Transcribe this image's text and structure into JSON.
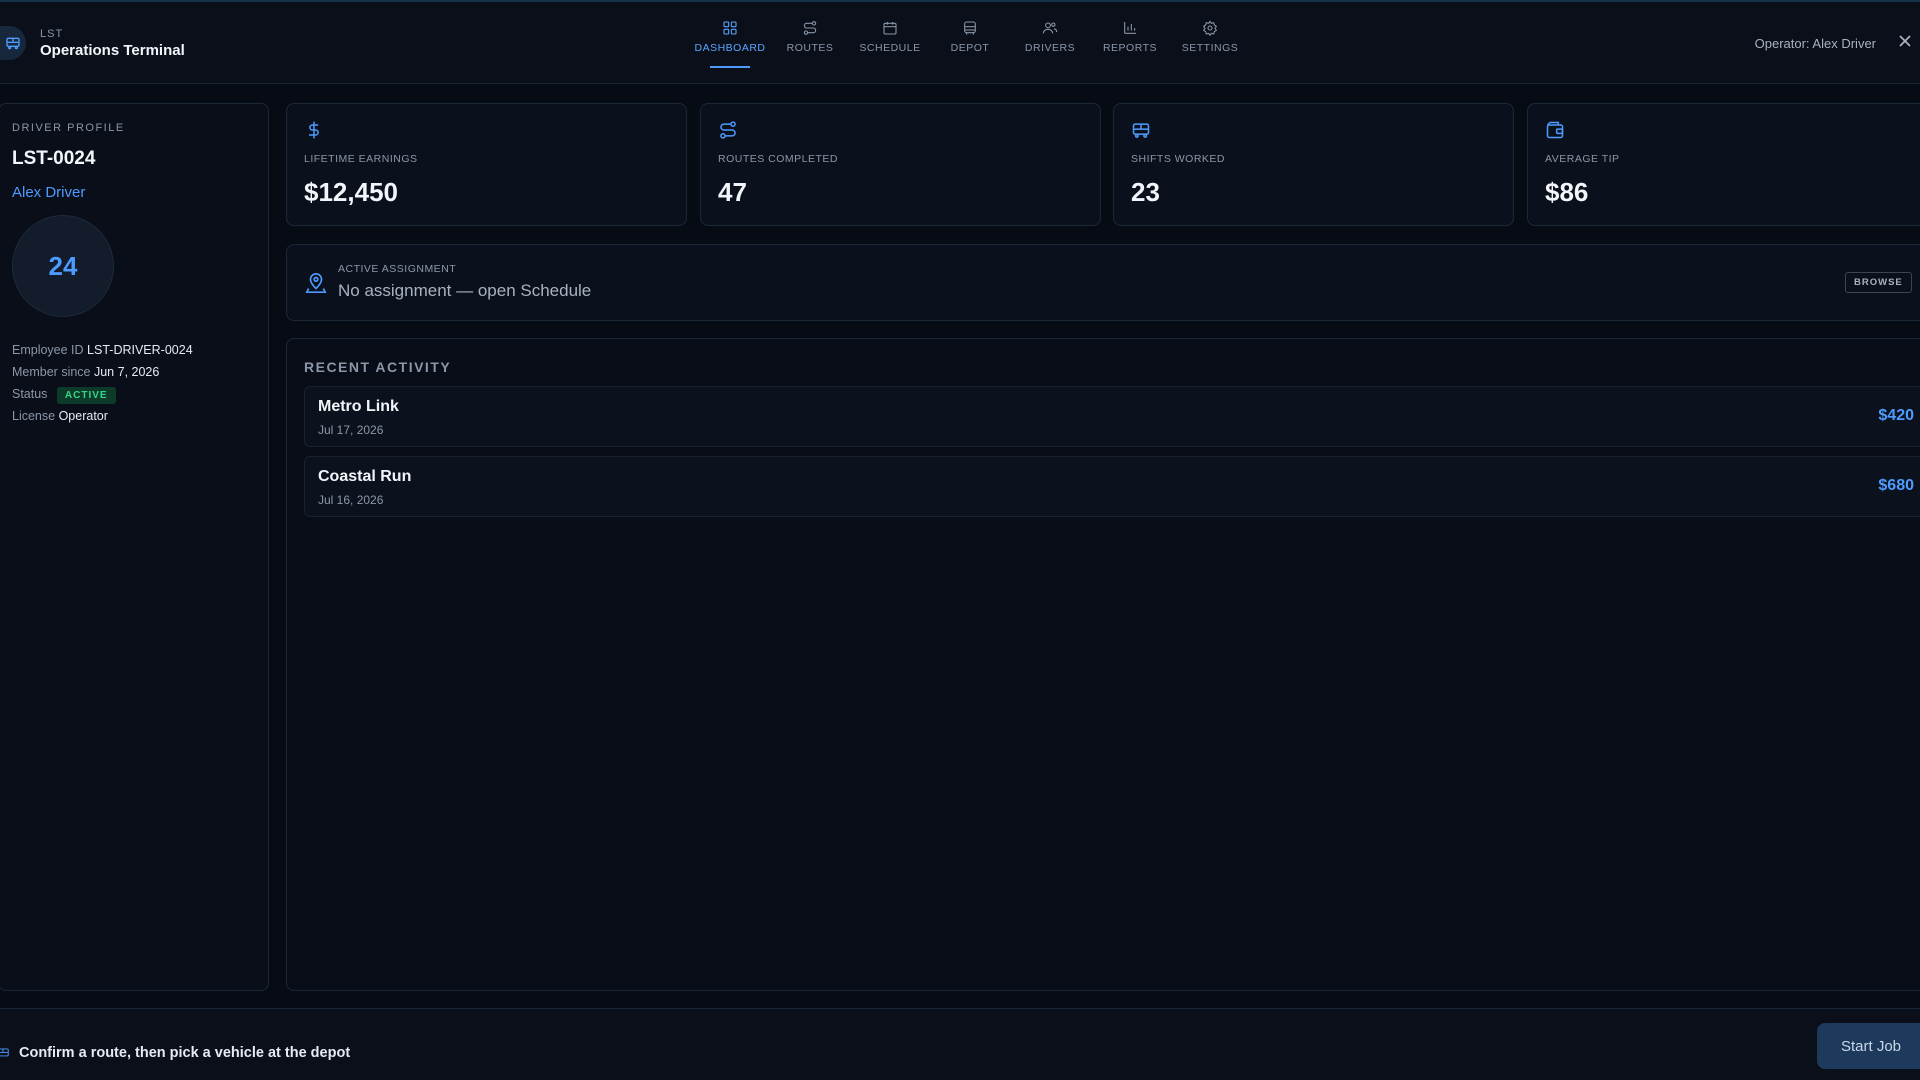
{
  "header": {
    "brand_sub": "LST",
    "brand_title": "Operations Terminal",
    "operator": "Operator: Alex Driver",
    "nav": [
      {
        "label": "DASHBOARD",
        "icon": "grid-icon",
        "active": true
      },
      {
        "label": "ROUTES",
        "icon": "route-icon",
        "active": false
      },
      {
        "label": "SCHEDULE",
        "icon": "calendar-icon",
        "active": false
      },
      {
        "label": "DEPOT",
        "icon": "bus-icon",
        "active": false
      },
      {
        "label": "DRIVERS",
        "icon": "users-icon",
        "active": false
      },
      {
        "label": "REPORTS",
        "icon": "bar-chart-icon",
        "active": false
      },
      {
        "label": "SETTINGS",
        "icon": "gear-icon",
        "active": false
      }
    ]
  },
  "profile": {
    "section_label": "DRIVER PROFILE",
    "id": "LST-0024",
    "name": "Alex Driver",
    "level": "24",
    "employee_id_label": "Employee ID",
    "employee_id": "LST-DRIVER-0024",
    "member_since_label": "Member since",
    "member_since": "Jun 7, 2026",
    "status_label": "Status",
    "status": "ACTIVE",
    "license_label": "License",
    "license": "Operator"
  },
  "stats": [
    {
      "label": "LIFETIME EARNINGS",
      "value": "$12,450",
      "icon": "dollar-icon"
    },
    {
      "label": "ROUTES COMPLETED",
      "value": "47",
      "icon": "route-icon"
    },
    {
      "label": "SHIFTS WORKED",
      "value": "23",
      "icon": "bus-icon"
    },
    {
      "label": "AVERAGE TIP",
      "value": "$86",
      "icon": "wallet-icon"
    }
  ],
  "assignment": {
    "label": "ACTIVE ASSIGNMENT",
    "text": "No assignment — open Schedule",
    "browse_label": "BROWSE"
  },
  "activity": {
    "title": "RECENT ACTIVITY",
    "items": [
      {
        "title": "Metro Link",
        "date": "Jul 17, 2026",
        "amount": "$420"
      },
      {
        "title": "Coastal Run",
        "date": "Jul 16, 2026",
        "amount": "$680"
      }
    ]
  },
  "footer": {
    "hint": "Confirm a route, then pick a vehicle at the depot",
    "start_label": "Start Job"
  },
  "colors": {
    "accent": "#4e9bff",
    "background": "#070b14",
    "status_active": "#36d48a",
    "button": "#1d3a5c"
  }
}
